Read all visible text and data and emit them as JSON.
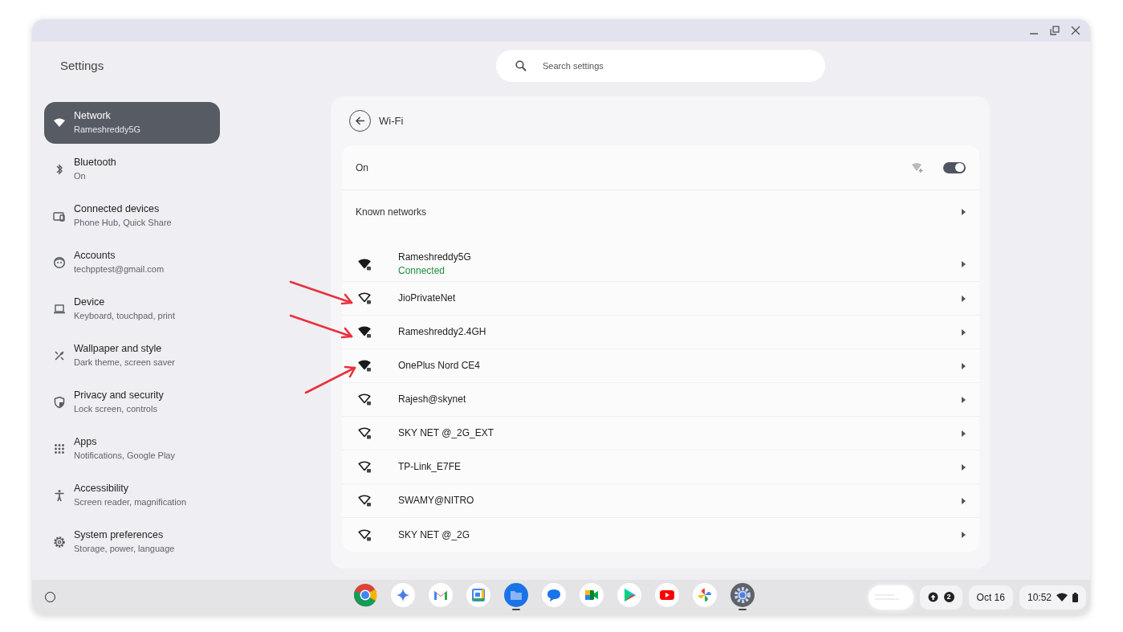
{
  "window": {
    "title": "Settings"
  },
  "search": {
    "placeholder": "Search settings"
  },
  "sidebar": {
    "items": [
      {
        "title": "Network",
        "subtitle": "Rameshreddy5G",
        "selected": true
      },
      {
        "title": "Bluetooth",
        "subtitle": "On",
        "selected": false
      },
      {
        "title": "Connected devices",
        "subtitle": "Phone Hub, Quick Share",
        "selected": false
      },
      {
        "title": "Accounts",
        "subtitle": "techpptest@gmail.com",
        "selected": false
      },
      {
        "title": "Device",
        "subtitle": "Keyboard, touchpad, print",
        "selected": false
      },
      {
        "title": "Wallpaper and style",
        "subtitle": "Dark theme, screen saver",
        "selected": false
      },
      {
        "title": "Privacy and security",
        "subtitle": "Lock screen, controls",
        "selected": false
      },
      {
        "title": "Apps",
        "subtitle": "Notifications, Google Play",
        "selected": false
      },
      {
        "title": "Accessibility",
        "subtitle": "Screen reader, magnification",
        "selected": false
      },
      {
        "title": "System preferences",
        "subtitle": "Storage, power, language",
        "selected": false
      }
    ]
  },
  "page": {
    "title": "Wi-Fi",
    "toggle_label": "On",
    "wifi_on": true,
    "known_networks": "Known networks",
    "networks": [
      {
        "name": "Rameshreddy5G",
        "status": "Connected",
        "strong_signal": true
      },
      {
        "name": "JioPrivateNet",
        "strong_signal": false,
        "arrow": true,
        "arrow_rising": false
      },
      {
        "name": "Rameshreddy2.4GH",
        "strong_signal": true,
        "arrow": true,
        "arrow_rising": false
      },
      {
        "name": "OnePlus Nord CE4",
        "strong_signal": true,
        "arrow": true,
        "arrow_rising": true
      },
      {
        "name": "Rajesh@skynet",
        "strong_signal": false
      },
      {
        "name": "SKY NET @_2G_EXT",
        "strong_signal": false
      },
      {
        "name": "TP-Link_E7FE",
        "strong_signal": false
      },
      {
        "name": "SWAMY@NITRO",
        "strong_signal": false
      },
      {
        "name": "SKY NET @_2G",
        "strong_signal": false
      }
    ]
  },
  "shelf": {
    "apps": [
      {
        "kind": "browser",
        "running": false
      },
      {
        "kind": "assistant",
        "running": false
      },
      {
        "kind": "mail",
        "running": false
      },
      {
        "kind": "calendar",
        "running": false
      },
      {
        "kind": "files",
        "running": true
      },
      {
        "kind": "chat",
        "running": false
      },
      {
        "kind": "video",
        "running": false
      },
      {
        "kind": "store",
        "running": false
      },
      {
        "kind": "player",
        "running": false
      },
      {
        "kind": "photos",
        "running": false
      },
      {
        "kind": "settings",
        "running": true
      }
    ],
    "notification_count": "2",
    "date": "Oct 16",
    "time": "10:52"
  }
}
